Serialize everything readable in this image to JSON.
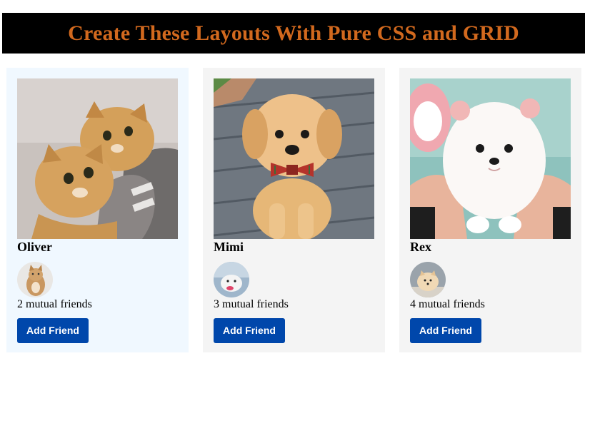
{
  "page": {
    "title": "Create These Layouts With Pure CSS and GRID",
    "title_color": "#d2691e",
    "banner_bg": "#000000"
  },
  "cards": [
    {
      "name": "Oliver",
      "photo_icon": "two-kittens-photo",
      "avatar_icon": "cat-avatar",
      "mutual": "2 mutual friends",
      "button_label": "Add Friend",
      "bg": "#f0f8ff"
    },
    {
      "name": "Mimi",
      "photo_icon": "golden-puppy-photo",
      "avatar_icon": "pet-avatar",
      "mutual": "3 mutual friends",
      "button_label": "Add Friend",
      "bg": "#f4f4f4"
    },
    {
      "name": "Rex",
      "photo_icon": "white-pomeranian-photo",
      "avatar_icon": "pomeranian-avatar",
      "mutual": "4 mutual friends",
      "button_label": "Add Friend",
      "bg": "#f4f4f4"
    }
  ],
  "colors": {
    "button_bg": "#0047ab",
    "button_text": "#ffffff"
  }
}
